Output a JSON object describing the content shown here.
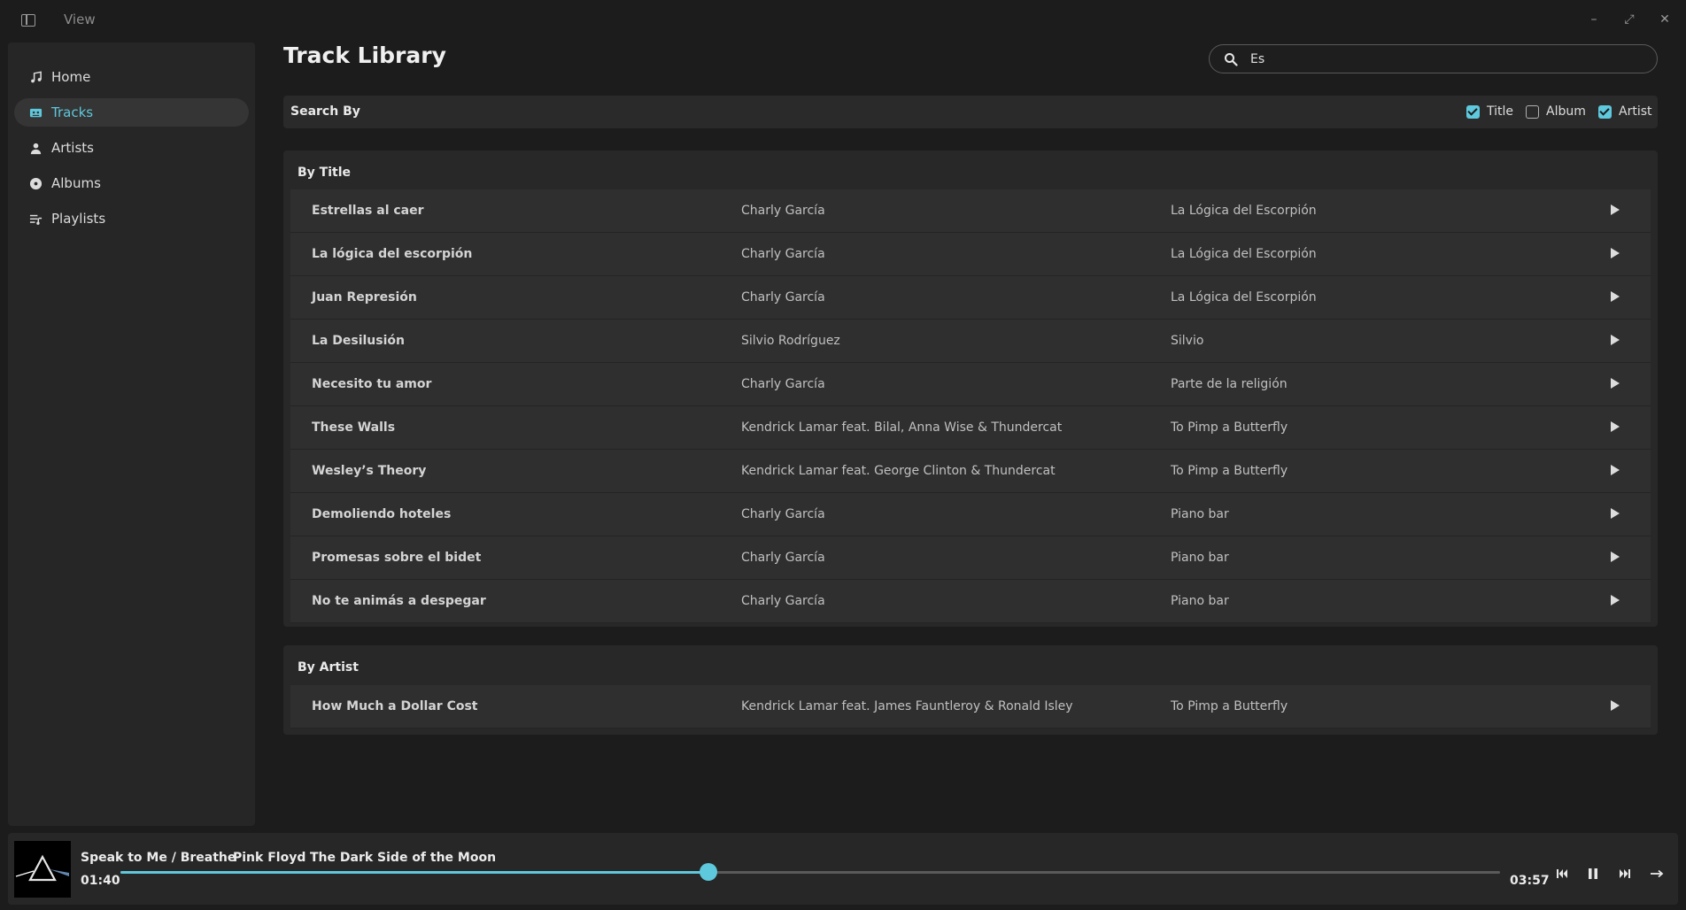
{
  "titlebar": {
    "view_label": "View"
  },
  "sidebar": {
    "items": [
      {
        "label": "Home",
        "icon": "music-note-icon",
        "active": false
      },
      {
        "label": "Tracks",
        "icon": "cassette-icon",
        "active": true
      },
      {
        "label": "Artists",
        "icon": "person-icon",
        "active": false
      },
      {
        "label": "Albums",
        "icon": "disc-icon",
        "active": false
      },
      {
        "label": "Playlists",
        "icon": "playlist-icon",
        "active": false
      }
    ]
  },
  "main": {
    "title": "Track Library",
    "search": {
      "value": "Es",
      "placeholder": ""
    },
    "search_by": {
      "label": "Search By",
      "options": [
        {
          "label": "Title",
          "checked": true
        },
        {
          "label": "Album",
          "checked": false
        },
        {
          "label": "Artist",
          "checked": true
        }
      ]
    },
    "groups": [
      {
        "title": "By Title",
        "rows": [
          {
            "title": "Estrellas al caer",
            "artist": "Charly García",
            "album": "La Lógica del Escorpión"
          },
          {
            "title": "La lógica del escorpión",
            "artist": "Charly García",
            "album": "La Lógica del Escorpión"
          },
          {
            "title": "Juan Represión",
            "artist": "Charly García",
            "album": "La Lógica del Escorpión"
          },
          {
            "title": "La Desilusión",
            "artist": "Silvio Rodríguez",
            "album": "Silvio"
          },
          {
            "title": "Necesito tu amor",
            "artist": "Charly García",
            "album": "Parte de la religión"
          },
          {
            "title": "These Walls",
            "artist": "Kendrick Lamar feat. Bilal, Anna Wise & Thundercat",
            "album": "To Pimp a Butterfly"
          },
          {
            "title": "Wesley’s Theory",
            "artist": "Kendrick Lamar feat. George Clinton & Thundercat",
            "album": "To Pimp a Butterfly"
          },
          {
            "title": "Demoliendo hoteles",
            "artist": "Charly García",
            "album": "Piano bar"
          },
          {
            "title": "Promesas sobre el bidet",
            "artist": "Charly García",
            "album": "Piano bar"
          },
          {
            "title": "No te animás a despegar",
            "artist": "Charly García",
            "album": "Piano bar"
          }
        ]
      },
      {
        "title": "By Artist",
        "rows": [
          {
            "title": "How Much a Dollar Cost",
            "artist": "Kendrick Lamar feat. James Fauntleroy & Ronald Isley",
            "album": "To Pimp a Butterfly"
          }
        ]
      }
    ]
  },
  "player": {
    "title": "Speak to Me / Breathe",
    "artist": "Pink Floyd",
    "album": "The Dark Side of the Moon",
    "elapsed": "01:40",
    "duration": "03:57",
    "progress": 0.426
  },
  "colors": {
    "accent": "#5ec8dc",
    "background": "#1c1c1c",
    "panel": "#282828"
  }
}
